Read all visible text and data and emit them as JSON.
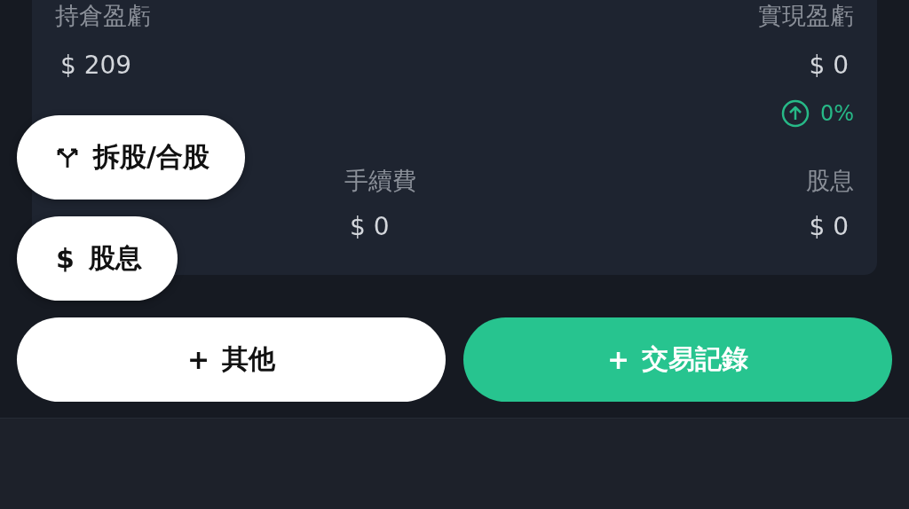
{
  "summary": {
    "row_1": [
      {
        "label": "持倉盈虧",
        "value": "$ 209"
      },
      {
        "label": "實現盈虧",
        "value": "$ 0",
        "change": "0%"
      }
    ],
    "row_2": [
      {
        "label": "手續費",
        "value": "$ 0"
      },
      {
        "label": "股息",
        "value": "$ 0"
      }
    ]
  },
  "quick_actions": [
    {
      "kind": "split",
      "label": "拆股/合股"
    },
    {
      "kind": "dividend",
      "icon": "$",
      "label": "股息"
    }
  ],
  "buttons": [
    {
      "kind": "secondary",
      "icon": "+",
      "label": "其他"
    },
    {
      "kind": "primary",
      "icon": "+",
      "label": "交易記錄"
    }
  ]
}
